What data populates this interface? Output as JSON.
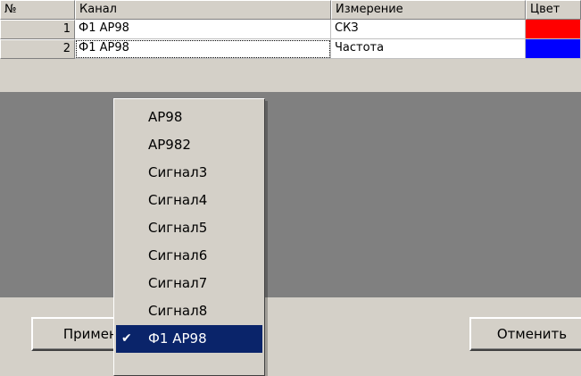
{
  "columns": {
    "num": "№",
    "channel": "Канал",
    "measurement": "Измерение",
    "color": "Цвет"
  },
  "rows": [
    {
      "num": "1",
      "channel": "Ф1 AP98",
      "measurement": "СКЗ",
      "color": "#ff0000"
    },
    {
      "num": "2",
      "channel": "Ф1 AP98",
      "measurement": "Частота",
      "color": "#0000ff"
    }
  ],
  "buttons": {
    "apply": "Применить",
    "cancel": "Отменить"
  },
  "dropdown": {
    "options": [
      "AP98",
      "AP982",
      "Сигнал3",
      "Сигнал4",
      "Сигнал5",
      "Сигнал6",
      "Сигнал7",
      "Сигнал8",
      "Ф1 AP98"
    ],
    "selected": "Ф1 AP98",
    "check_icon": "✔"
  }
}
